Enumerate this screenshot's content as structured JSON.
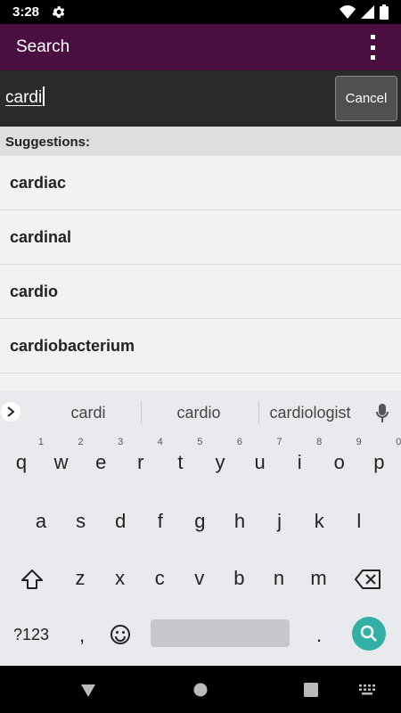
{
  "status_bar": {
    "time": "3:28"
  },
  "app_bar": {
    "title": "Search"
  },
  "search": {
    "query": "cardi",
    "cancel_label": "Cancel"
  },
  "suggestions": {
    "header": "Suggestions:",
    "items": [
      "cardiac",
      "cardinal",
      "cardio",
      "cardiobacterium"
    ]
  },
  "keyboard": {
    "word_suggestions": [
      "cardi",
      "cardio",
      "cardiologist"
    ],
    "row1": [
      "q",
      "w",
      "e",
      "r",
      "t",
      "y",
      "u",
      "i",
      "o",
      "p"
    ],
    "row1_hints": [
      "1",
      "2",
      "3",
      "4",
      "5",
      "6",
      "7",
      "8",
      "9",
      "0"
    ],
    "row2": [
      "a",
      "s",
      "d",
      "f",
      "g",
      "h",
      "j",
      "k",
      "l"
    ],
    "row3": [
      "z",
      "x",
      "c",
      "v",
      "b",
      "n",
      "m"
    ],
    "symbols_label": "?123",
    "comma": ",",
    "period": "."
  },
  "colors": {
    "app_bar": "#4a0f40",
    "accent": "#33b0a6"
  }
}
